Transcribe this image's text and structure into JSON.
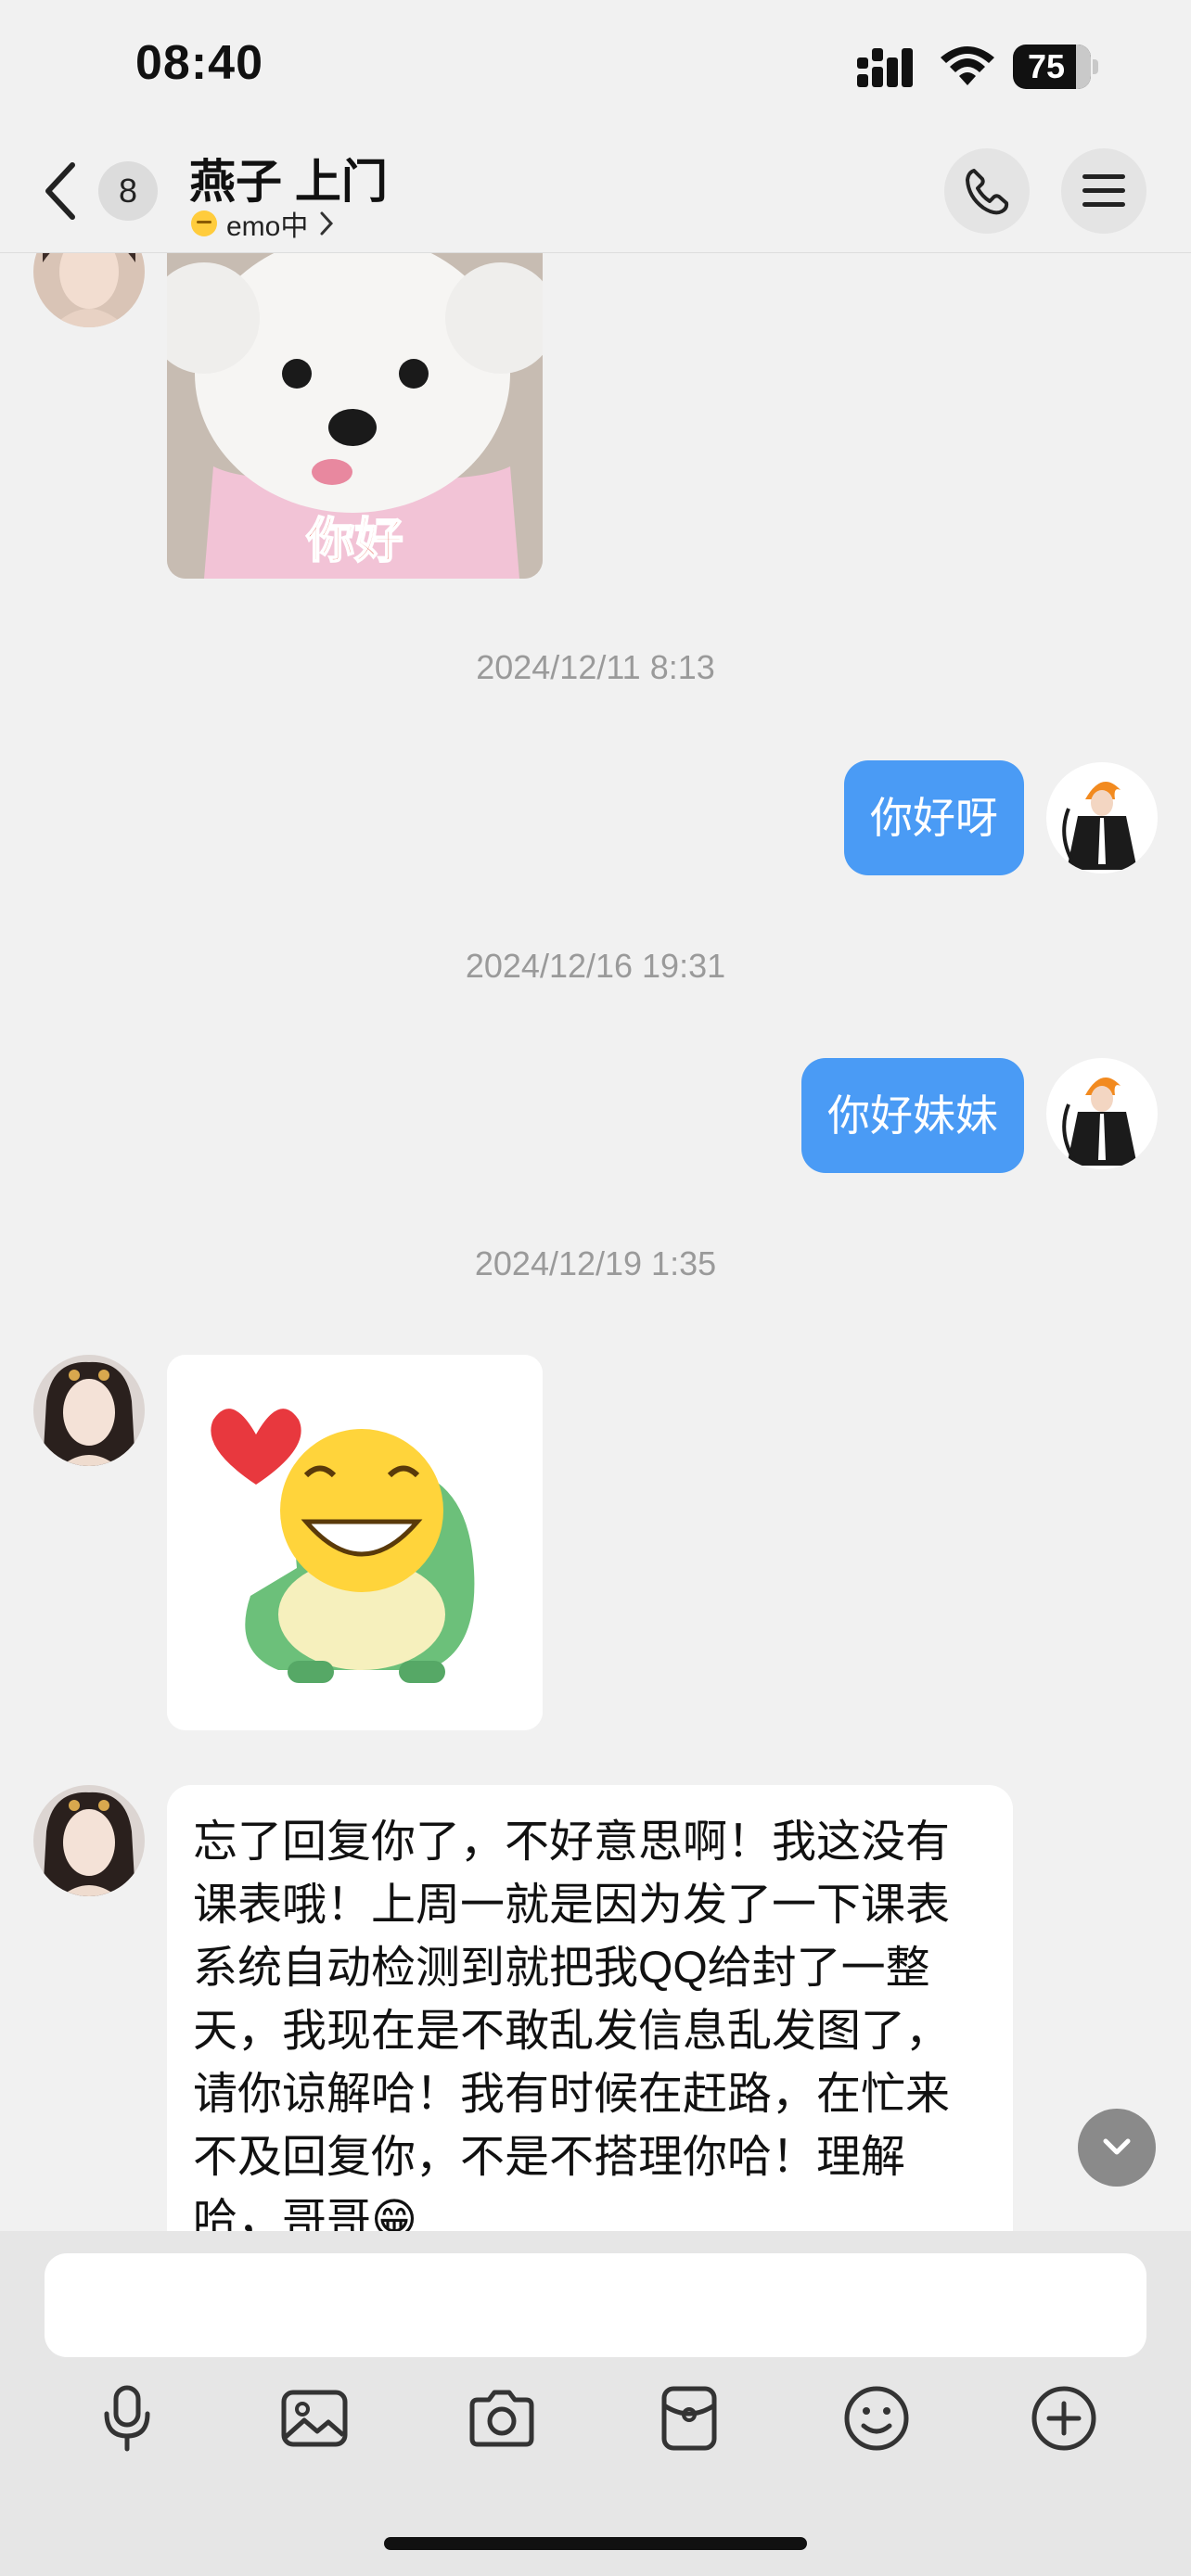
{
  "status_bar": {
    "time": "08:40",
    "battery": "75"
  },
  "header": {
    "back_badge": "8",
    "contact_name": "燕子 上门",
    "contact_status": "emo中"
  },
  "messages": {
    "sticker1_text": "你好",
    "ts1": "2024/12/11 8:13",
    "out1": "你好呀",
    "ts2": "2024/12/16 19:31",
    "out2": "你好妹妹",
    "ts3": "2024/12/19 1:35",
    "in_text": "忘了回复你了，不好意思啊！我这没有课表哦！上周一就是因为发了一下课表系统自动检测到就把我QQ给封了一整天，我现在是不敢乱发信息乱发图了，请你谅解哈！我有时候在赶路，在忙来不及回复你，不是不搭理你哈！理解哈，哥哥😁"
  },
  "input": {
    "placeholder": ""
  },
  "colors": {
    "accent": "#4a9bf5",
    "background": "#f1f1f1",
    "panel": "#e6e6e6"
  },
  "icons": [
    "back-icon",
    "phone-icon",
    "menu-icon",
    "chevron-down-icon",
    "microphone-icon",
    "image-icon",
    "camera-icon",
    "red-packet-icon",
    "emoji-icon",
    "plus-icon"
  ]
}
